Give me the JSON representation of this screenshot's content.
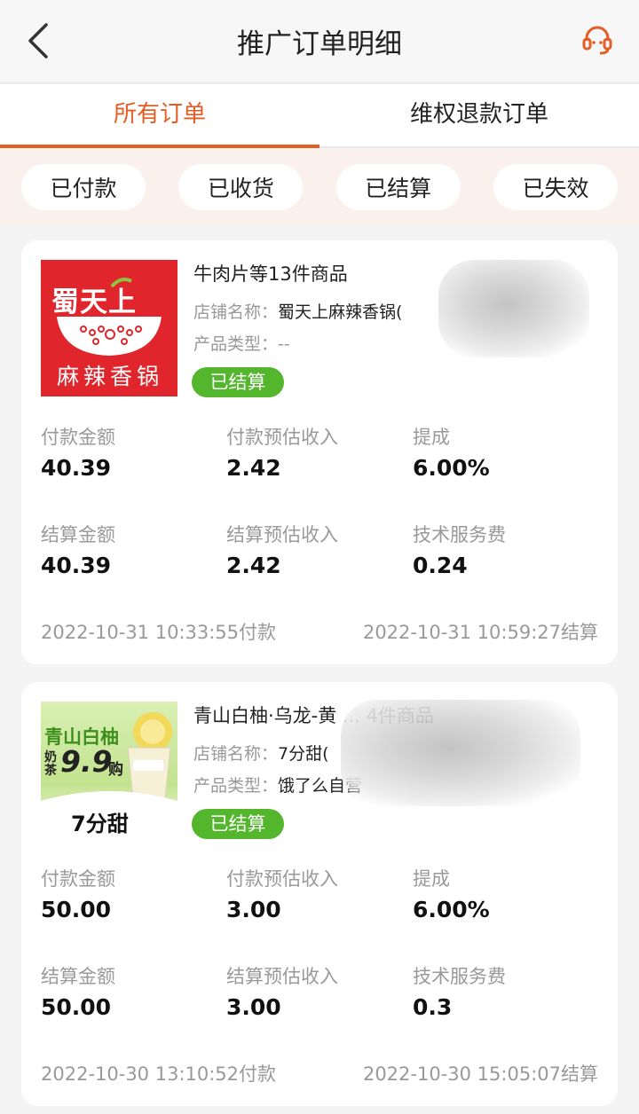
{
  "header": {
    "title": "推广订单明细"
  },
  "tabs": [
    {
      "label": "所有订单",
      "active": true
    },
    {
      "label": "维权退款订单",
      "active": false
    }
  ],
  "filters": [
    "已付款",
    "已收货",
    "已结算",
    "已失效"
  ],
  "labels": {
    "shop_name": "店铺名称：",
    "product_type": "产品类型：",
    "pay_amount": "付款金额",
    "pay_est_income": "付款预估收入",
    "commission": "提成",
    "settle_amount": "结算金额",
    "settle_est_income": "结算预估收入",
    "service_fee": "技术服务费"
  },
  "orders": [
    {
      "title": "牛肉片等13件商品",
      "shop_name": "蜀天上麻辣香锅(",
      "product_type": "--",
      "status": "已结算",
      "thumb_text_top": "蜀天上",
      "thumb_text_bottom": "麻辣香锅",
      "pay_amount": "40.39",
      "pay_est_income": "2.42",
      "commission": "6.00%",
      "settle_amount": "40.39",
      "settle_est_income": "2.42",
      "service_fee": "0.24",
      "pay_time": "2022-10-31 10:33:55付款",
      "settle_time": "2022-10-31 10:59:27结算"
    },
    {
      "title": "青山白柚·乌龙-黄 ... 4件商品",
      "shop_name": "7分甜(",
      "product_type": "饿了么自营",
      "status": "已结算",
      "thumb_text_top": "青山白柚",
      "thumb_text_milk": "奶茶",
      "thumb_price": "9.9",
      "thumb_buy": "购",
      "thumb_brand": "7分甜",
      "pay_amount": "50.00",
      "pay_est_income": "3.00",
      "commission": "6.00%",
      "settle_amount": "50.00",
      "settle_est_income": "3.00",
      "service_fee": "0.3",
      "pay_time": "2022-10-30 13:10:52付款",
      "settle_time": "2022-10-30 15:05:07结算"
    }
  ],
  "colors": {
    "accent": "#e35d24",
    "status_green": "#53b62c",
    "filter_bg": "#fbf1ec",
    "logo_red": "#e0262c"
  },
  "icons": {
    "back": "chevron-left-icon",
    "service": "headset-icon"
  }
}
